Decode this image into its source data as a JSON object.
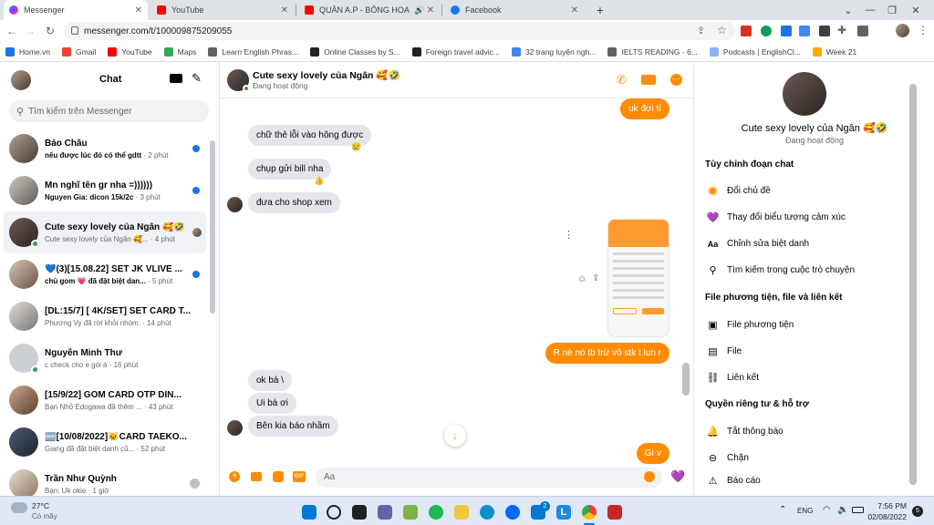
{
  "browser": {
    "tabs": [
      {
        "title": "Messenger"
      },
      {
        "title": "YouTube"
      },
      {
        "title": "QUÂN A.P - BÔNG HOA ĐẸP"
      },
      {
        "title": "Facebook"
      }
    ],
    "url": "messenger.com/t/100009875209055",
    "bookmarks": [
      "Home.vn",
      "Gmail",
      "YouTube",
      "Maps",
      "Learn English Phras...",
      "Online Classes by S...",
      "Foreign travel advic...",
      "32 trang luyện ngh...",
      "IELTS READING - 6...",
      "Podcasts | EnglishCl...",
      "Week 21"
    ]
  },
  "sidebar": {
    "title": "Chat",
    "search_placeholder": "Tìm kiếm trên Messenger",
    "conversations": [
      {
        "name": "Bảo Châu",
        "preview": "nếu được lúc đó có thể gdtt",
        "time": "· 2 phút"
      },
      {
        "name": "Mn nghĩ tên gr nha =))))))",
        "preview": "Nguyen Gia: dicon 15k/2c",
        "time": "· 3 phút"
      },
      {
        "name": "Cute sexy lovely của Ngân 🥰🤣",
        "preview": "Cute sexy lovely của Ngân 🥰...",
        "time": "· 4 phút"
      },
      {
        "name": "💙(3)[15.08.22] SET JK VLIVE ...",
        "preview": "chủ gom 💗 đã đặt biệt dan...",
        "time": "· 5 phút"
      },
      {
        "name": "[DL:15/7] [ 4K/SET] SET CARD T...",
        "preview": "Phương Vy đã rời khỏi nhóm.",
        "time": "· 14 phút"
      },
      {
        "name": "Nguyễn Minh Thư",
        "preview": "c check cho e gói á",
        "time": "· 16 phút"
      },
      {
        "name": "[15/9/22] GOM CARD OTP DÍN...",
        "preview": "Bạn Nhỏ Edogawa đã thêm ...",
        "time": "· 43 phút"
      },
      {
        "name": "🆕[10/08/2022]🐱CARD TAEKO...",
        "preview": "Giang đã đặt biệt danh cũ...",
        "time": "· 52 phút"
      },
      {
        "name": "Trần Như Quỳnh",
        "preview": "Bạn: Uk okie",
        "time": "· 1 giờ"
      }
    ]
  },
  "chat": {
    "name": "Cute sexy lovely của Ngân 🥰🤣",
    "status": "Đang hoạt động",
    "messages": [
      {
        "dir": "out",
        "text": "uk đợi tí"
      },
      {
        "dir": "in",
        "text": "chữ thẻ lỗi vào hông được",
        "reaction": "😢"
      },
      {
        "dir": "in",
        "text": "chụp gửi bill nha",
        "reaction": "👍"
      },
      {
        "dir": "in",
        "text": "đưa cho shop xem"
      },
      {
        "dir": "out",
        "text": "R nè nó tb trừ vô stk t lun r"
      },
      {
        "dir": "in",
        "text": "ok bà \\"
      },
      {
        "dir": "in",
        "text": "Ui  bà ơi"
      },
      {
        "dir": "in",
        "text": "Bên kia báo nhầm"
      },
      {
        "dir": "out",
        "text": "Gì v"
      }
    ],
    "input_placeholder": "Aa"
  },
  "info": {
    "name": "Cute sexy lovely của Ngân 🥰🤣",
    "status": "Đang hoạt động",
    "sections": [
      {
        "title": "Tùy chỉnh đoạn chat",
        "items": [
          "Đổi chủ đề",
          "Thay đổi biểu tượng cảm xúc",
          "Chỉnh sửa biệt danh",
          "Tìm kiếm trong cuộc trò chuyện"
        ]
      },
      {
        "title": "File phương tiện, file và liên kết",
        "items": [
          "File phương tiện",
          "File",
          "Liên kết"
        ]
      },
      {
        "title": "Quyền riêng tư & hỗ trợ",
        "items": [
          "Tắt thông báo",
          "Chặn",
          "Báo cáo"
        ]
      }
    ]
  },
  "taskbar": {
    "temp": "27°C",
    "weather": "Có mây",
    "lang": "ENG",
    "time": "7:56 PM",
    "date": "02/08/2022",
    "badge": "2",
    "notif": "5"
  }
}
